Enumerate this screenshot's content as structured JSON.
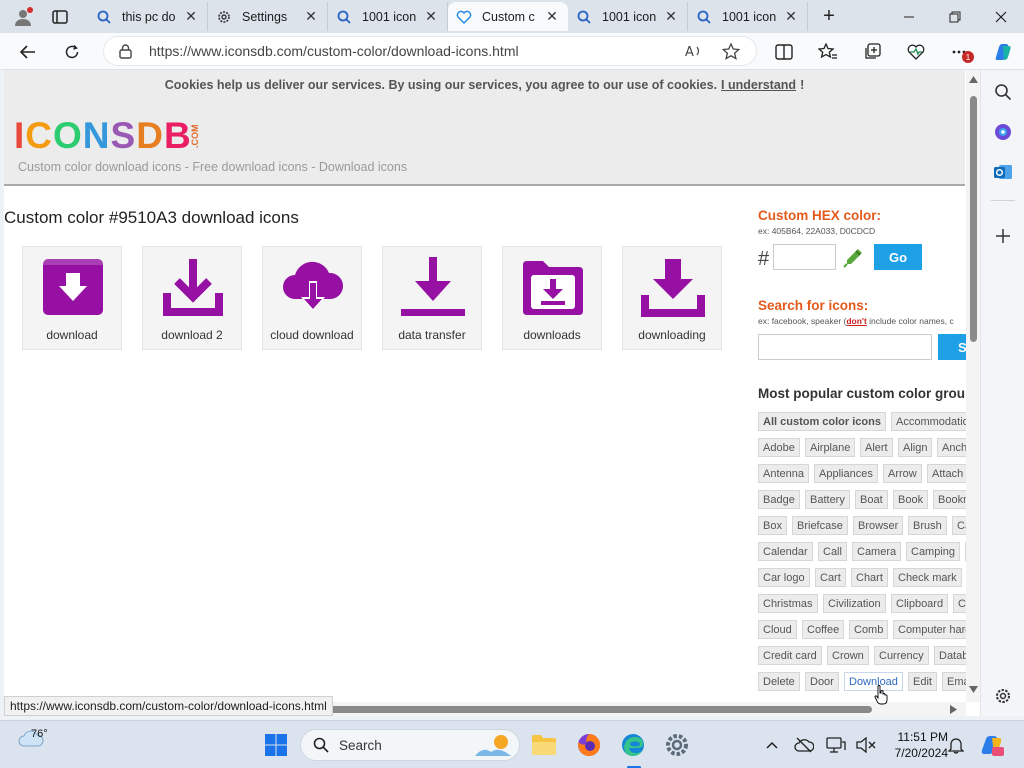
{
  "tabs": [
    {
      "label": "this pc do",
      "icon": "search-icon",
      "active": false
    },
    {
      "label": "Settings",
      "icon": "gear-icon",
      "active": false
    },
    {
      "label": "1001 icon",
      "icon": "search-icon",
      "active": false
    },
    {
      "label": "Custom c",
      "icon": "heart-icon",
      "active": true
    },
    {
      "label": "1001 icon",
      "icon": "search-icon",
      "active": false
    },
    {
      "label": "1001 icon",
      "icon": "search-icon",
      "active": false
    }
  ],
  "tab_close_glyph": "✕",
  "new_tab_glyph": "+",
  "address": {
    "url": "https://www.iconsdb.com/custom-color/download-icons.html"
  },
  "extension_badge": "1",
  "cookie": {
    "text": "Cookies help us deliver our services. By using our services, you agree to our use of cookies.",
    "link": "I understand",
    "suffix": "!"
  },
  "site": {
    "logo_text": "ICONSDB",
    "logo_suffix": ".COM",
    "tagline": "Custom color download icons - Free download icons - Download icons"
  },
  "page_title": "Custom color #9510A3 download icons",
  "icon_color": "#9510A3",
  "icons": [
    {
      "label": "download",
      "icon": "download-box-icon"
    },
    {
      "label": "download 2",
      "icon": "download-tray-icon"
    },
    {
      "label": "cloud download",
      "icon": "cloud-download-icon"
    },
    {
      "label": "data transfer",
      "icon": "data-transfer-icon"
    },
    {
      "label": "downloads",
      "icon": "folder-download-icon"
    },
    {
      "label": "downloading",
      "icon": "downloading-icon"
    }
  ],
  "hex": {
    "heading": "Custom HEX color:",
    "example": "ex: 405B64, 22A033, D0CDCD",
    "hash": "#",
    "value": "",
    "go": "Go"
  },
  "search": {
    "heading": "Search for icons:",
    "example_prefix": "ex: facebook, speaker (",
    "example_dont": "don't",
    "example_suffix": " include color names, c",
    "value": "",
    "button": "S"
  },
  "groups": {
    "title": "Most popular custom color grou",
    "tags": [
      [
        "All custom color icons",
        "Accommodatio"
      ],
      [
        "Adobe",
        "Airplane",
        "Alert",
        "Align",
        "Ancho"
      ],
      [
        "Antenna",
        "Appliances",
        "Arrow",
        "Attach"
      ],
      [
        "Badge",
        "Battery",
        "Boat",
        "Book",
        "Bookma"
      ],
      [
        "Box",
        "Briefcase",
        "Browser",
        "Brush",
        "Cale"
      ],
      [
        "Calendar",
        "Call",
        "Camera",
        "Camping",
        "C"
      ],
      [
        "Car logo",
        "Cart",
        "Chart",
        "Check mark",
        "("
      ],
      [
        "Christmas",
        "Civilization",
        "Clipboard",
        "Clo"
      ],
      [
        "Cloud",
        "Coffee",
        "Comb",
        "Computer hard"
      ],
      [
        "Credit card",
        "Crown",
        "Currency",
        "Databa"
      ],
      [
        "Delete",
        "Door",
        "Download",
        "Edit",
        "Email"
      ]
    ]
  },
  "status_url": "https://www.iconsdb.com/custom-color/download-icons.html",
  "taskbar": {
    "weather": "76°",
    "search_label": "Search",
    "time": "11:51 PM",
    "date": "7/20/2024"
  }
}
